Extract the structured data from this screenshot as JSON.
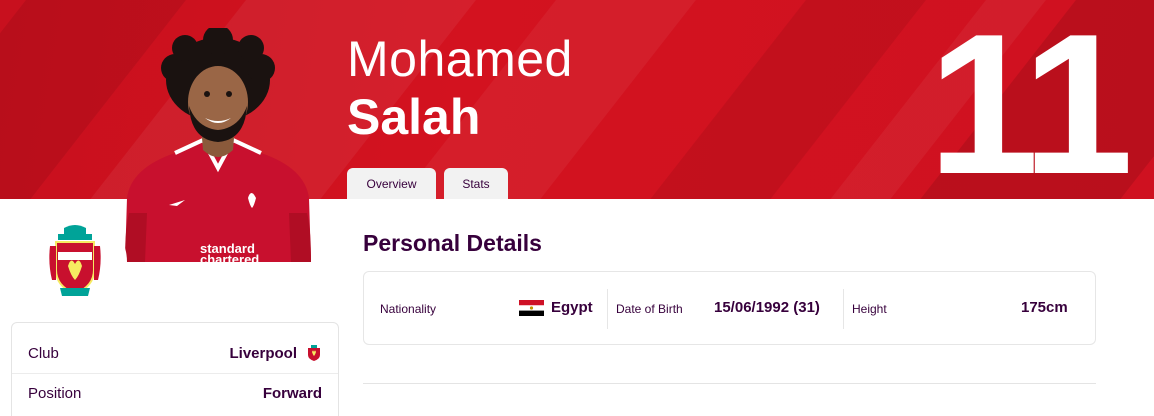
{
  "player": {
    "first_name": "Mohamed",
    "last_name": "Salah",
    "shirt_number": "11"
  },
  "tabs": [
    {
      "label": "Overview"
    },
    {
      "label": "Stats"
    }
  ],
  "club_info": {
    "rows": [
      {
        "label": "Club",
        "value": "Liverpool",
        "icon": "liverpool-crest-icon"
      },
      {
        "label": "Position",
        "value": "Forward"
      }
    ]
  },
  "personal_details": {
    "title": "Personal Details",
    "nationality": {
      "label": "Nationality",
      "value": "Egypt",
      "icon": "egypt-flag-icon"
    },
    "dob": {
      "label": "Date of Birth",
      "value": "15/06/1992 (31)"
    },
    "height": {
      "label": "Height",
      "value": "175cm"
    }
  },
  "colors": {
    "brand_red": "#c8101e",
    "text_purple": "#37003c",
    "crest_green": "#00a398"
  }
}
